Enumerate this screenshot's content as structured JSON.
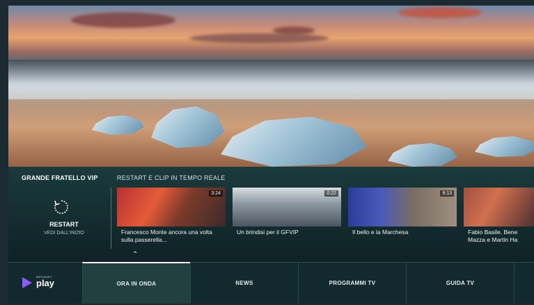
{
  "strip": {
    "title": "GRANDE FRATELLO VIP",
    "subtitle": "RESTART E CLIP IN TEMPO REALE",
    "restart_label": "RESTART",
    "restart_sub": "VEDI DALL'INIZIO"
  },
  "cards": [
    {
      "text": "Francesco Monte ancora una volta sulla passerella...",
      "duration": "3:24"
    },
    {
      "text": "Un brindisi per il GFVIP",
      "duration": "0:22"
    },
    {
      "text": "Il bello e la Marchesa",
      "duration": "9:13"
    },
    {
      "text": "Fabio Basile, Bene Mazza e Martin Ha",
      "duration": ""
    }
  ],
  "nav": {
    "logo_small": "MEDIASET",
    "logo_text": "play",
    "tabs": [
      "ORA IN ONDA",
      "NEWS",
      "PROGRAMMI TV",
      "GUIDA TV"
    ],
    "active_tab": "ORA IN ONDA"
  },
  "icons": {
    "restart": "restart-icon",
    "chevron": "chevron-up-icon",
    "logo": "play-triangle-icon"
  },
  "colors": {
    "accent": "#8b5cf6",
    "strip_bg": "#1b3a3b",
    "nav_bg": "#122a2e"
  }
}
